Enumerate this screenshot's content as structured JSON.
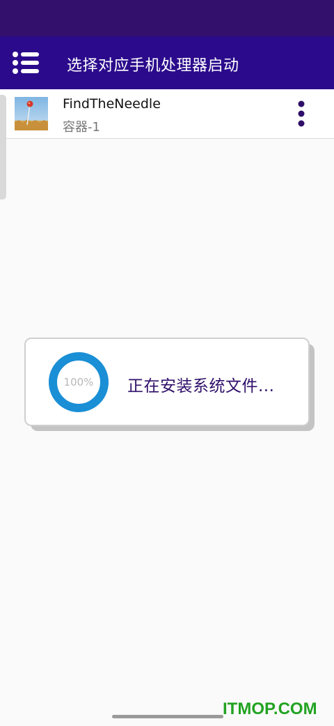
{
  "app_bar": {
    "title": "选择对应手机处理器启动",
    "menu_icon": "menu-list-icon"
  },
  "app_list": [
    {
      "name": "FindTheNeedle",
      "container": "容器-1",
      "thumbnail_icon": "needle-field-thumbnail",
      "more_icon": "more-vert-icon"
    }
  ],
  "install_dialog": {
    "progress_label": "100%",
    "progress_fraction": 1.0,
    "message": "正在安装系统文件..."
  },
  "watermark": "ITMOP.COM",
  "colors": {
    "status_bar": "#33106b",
    "app_bar": "#2b0b8c",
    "progress_ring": "#1a8fd6",
    "dialog_text": "#2f0f6a",
    "watermark": "#22a322"
  }
}
